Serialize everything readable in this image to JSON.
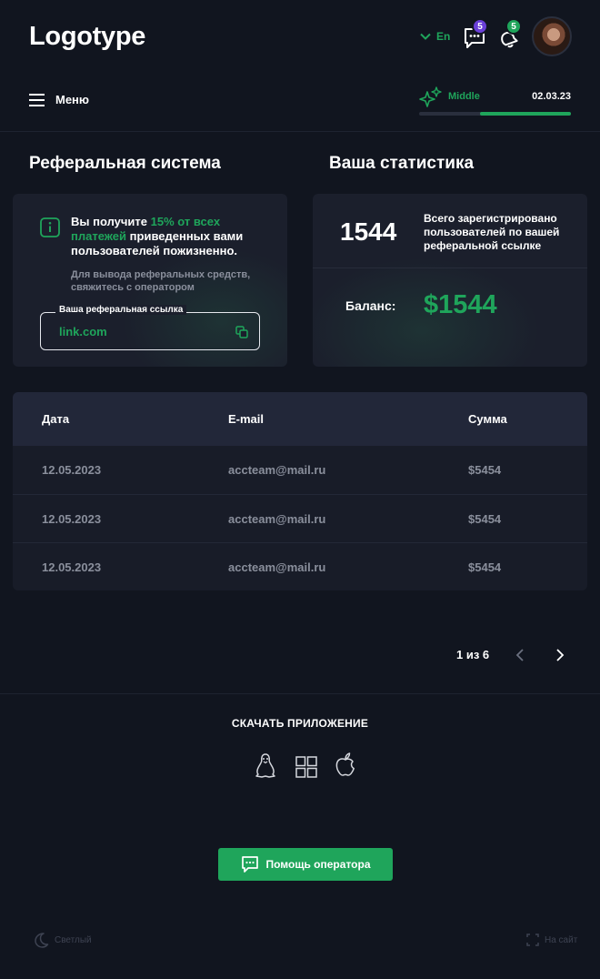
{
  "header": {
    "logo": "Logotype",
    "language": "En",
    "messages_count": "5",
    "notifications_count": "5"
  },
  "nav": {
    "menu_label": "Меню",
    "level_label": "Middle",
    "level_date": "02.03.23",
    "level_progress": 0.6
  },
  "referral": {
    "title": "Реферальная система",
    "text_before": "Вы получите ",
    "text_highlight": "15% от всех платежей",
    "text_after": " приведенных вами пользователей пожизненно.",
    "note": "Для вывода реферальных средств, свяжитесь с оператором",
    "link_label": "Ваша реферальная ссылка",
    "link_value": "link.com"
  },
  "stats": {
    "title": "Ваша статистика",
    "registered_count": "1544",
    "registered_label": "Всего зарегистрировано пользователей по вашей реферальной ссылке",
    "balance_label": "Баланс:",
    "balance_value": "$1544"
  },
  "table": {
    "headers": [
      "Дата",
      "E-mail",
      "Сумма"
    ],
    "rows": [
      [
        "12.05.2023",
        "accteam@mail.ru",
        "$5454"
      ],
      [
        "12.05.2023",
        "accteam@mail.ru",
        "$5454"
      ],
      [
        "12.05.2023",
        "accteam@mail.ru",
        "$5454"
      ]
    ]
  },
  "pagination": {
    "label": "1 из 6"
  },
  "download": {
    "title": "СКАЧАТЬ ПРИЛОЖЕНИЕ",
    "icons": [
      "linux-icon",
      "windows-icon",
      "apple-icon"
    ]
  },
  "help_button": {
    "label": "Помощь оператора"
  },
  "footer": {
    "theme_label": "Светлый",
    "site_label": "На сайт"
  },
  "colors": {
    "accent": "#1fa55b",
    "background": "#11151f",
    "card": "#1b1f2c",
    "messages_badge": "#6a3fd8",
    "notifications_badge": "#1fa55b"
  }
}
